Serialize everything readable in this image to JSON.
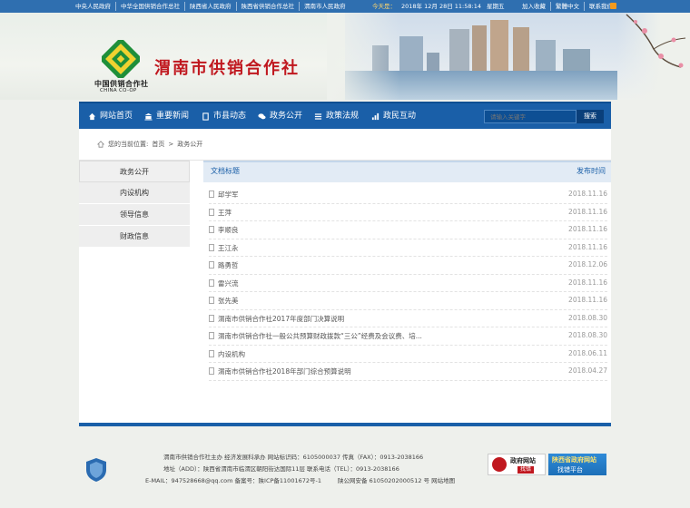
{
  "top_links": [
    "中央人民政府",
    "中华全国供销合作总社",
    "陕西省人民政府",
    "陕西省供销合作总社",
    "渭南市人民政府"
  ],
  "today": {
    "label": "今天是：",
    "date": "2018年 12月 28日 11:58:14",
    "weekday": "星期五"
  },
  "top_right": [
    "加入收藏",
    "繁體中文",
    "联系我们"
  ],
  "logo": {
    "cn": "中国供销合作社",
    "en": "CHINA CO-OP"
  },
  "site_title": "渭南市供销合作社",
  "nav": {
    "items": [
      {
        "label": "网站首页",
        "icon": "home-icon"
      },
      {
        "label": "重要新闻",
        "icon": "bank-icon"
      },
      {
        "label": "市县动态",
        "icon": "document-icon"
      },
      {
        "label": "政务公开",
        "icon": "comments-icon"
      },
      {
        "label": "政策法规",
        "icon": "list-icon"
      },
      {
        "label": "政民互动",
        "icon": "chart-icon"
      }
    ],
    "search_placeholder": "请输入关键字",
    "search_button": "搜索"
  },
  "breadcrumb": {
    "prefix": "您的当前位置:",
    "home": "首页",
    "sep": ">",
    "current": "政务公开"
  },
  "sidebar": {
    "title": "政务公开",
    "items": [
      "内设机构",
      "领导信息",
      "财政信息"
    ]
  },
  "table": {
    "col_title": "文档标题",
    "col_date": "发布时间",
    "rows": [
      {
        "title": "邱学军",
        "date": "2018.11.16"
      },
      {
        "title": "王萍",
        "date": "2018.11.16"
      },
      {
        "title": "李顺良",
        "date": "2018.11.16"
      },
      {
        "title": "王江永",
        "date": "2018.11.16"
      },
      {
        "title": "路勇哲",
        "date": "2018.12.06"
      },
      {
        "title": "雷兴流",
        "date": "2018.11.16"
      },
      {
        "title": "张先美",
        "date": "2018.11.16"
      },
      {
        "title": "渭南市供销合作社2017年度部门决算说明",
        "date": "2018.08.30"
      },
      {
        "title": "渭南市供销合作社一般公共预算财政拨款“三公”经费及会议费、培...",
        "date": "2018.08.30"
      },
      {
        "title": "内设机构",
        "date": "2018.06.11"
      },
      {
        "title": "渭南市供销合作社2018年部门综合预算说明",
        "date": "2018.04.27"
      }
    ]
  },
  "footer": {
    "line1": "渭南市供销合作社主办 经济发展科承办 网站标识码：6105000037 传真（FAX）：0913-2038166",
    "line2": "地址（ADD）：陕西省渭南市临渭区朝阳街达国际11层 联系电话（TEL）：0913-2038166",
    "line3": "E-MAIL：947528668@qq.com   备案号：陕ICP备11001672号-1",
    "line4": "陕公网安备 61050202000512 号   网站地图",
    "gov_logo_1": "政府网站",
    "gov_logo_2": "找错",
    "report_1": "陕西省政府网站",
    "report_2": "找错平台"
  },
  "colors": {
    "nav_blue": "#1a5fa8",
    "title_red": "#c0181f"
  }
}
